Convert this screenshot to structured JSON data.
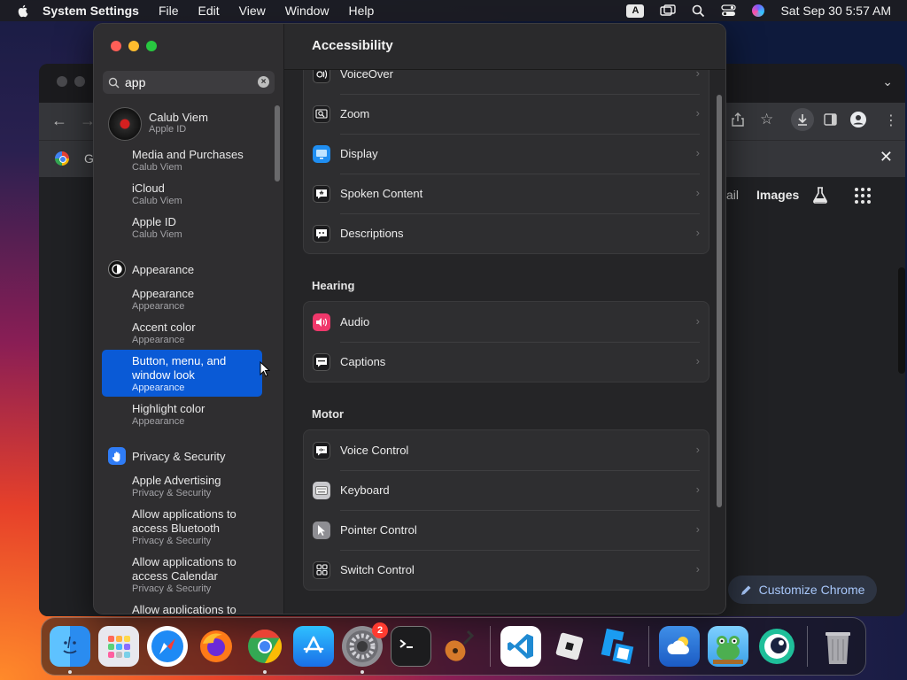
{
  "menubar": {
    "app_name": "System Settings",
    "items": [
      "File",
      "Edit",
      "View",
      "Window",
      "Help"
    ],
    "input_source": "A",
    "clock": "Sat Sep 30  5:57 AM"
  },
  "chrome": {
    "tab_label": "G",
    "nav_links": [
      "ail",
      "Images"
    ],
    "customize_label": "Customize Chrome"
  },
  "settings": {
    "search": {
      "value": "app"
    },
    "account": {
      "name": "Calub Viem",
      "subtitle": "Apple ID"
    },
    "sidebar": [
      {
        "title": "Media and Purchases",
        "sub": "Calub Viem"
      },
      {
        "title": "iCloud",
        "sub": "Calub Viem"
      },
      {
        "title": "Apple ID",
        "sub": "Calub Viem"
      },
      {
        "category": "Appearance"
      },
      {
        "title": "Appearance",
        "sub": "Appearance"
      },
      {
        "title": "Accent color",
        "sub": "Appearance"
      },
      {
        "title": "Button, menu, and window look",
        "sub": "Appearance",
        "selected": true
      },
      {
        "title": "Highlight color",
        "sub": "Appearance"
      },
      {
        "category": "Privacy & Security"
      },
      {
        "title": "Apple Advertising",
        "sub": "Privacy & Security"
      },
      {
        "title": "Allow applications to access Bluetooth",
        "sub": "Privacy & Security"
      },
      {
        "title": "Allow applications to access Calendar",
        "sub": "Privacy & Security"
      },
      {
        "title": "Allow applications to"
      }
    ],
    "main": {
      "title": "Accessibility",
      "vision_rows": [
        "VoiceOver",
        "Zoom",
        "Display",
        "Spoken Content",
        "Descriptions"
      ],
      "hearing_header": "Hearing",
      "hearing_rows": [
        "Audio",
        "Captions"
      ],
      "motor_header": "Motor",
      "motor_rows": [
        "Voice Control",
        "Keyboard",
        "Pointer Control",
        "Switch Control"
      ]
    }
  },
  "dock": {
    "apps": [
      "Finder",
      "Launchpad",
      "Safari",
      "Firefox",
      "Google Chrome",
      "App Store",
      "System Settings",
      "Terminal",
      "GarageBand",
      "Visual Studio Code",
      "Roblox",
      "Roblox Studio",
      "Weather",
      "Frogger",
      "Comet"
    ],
    "settings_badge": "2"
  },
  "colors": {
    "selection": "#0a5ad6",
    "accent_blue": "#0a84ff"
  }
}
